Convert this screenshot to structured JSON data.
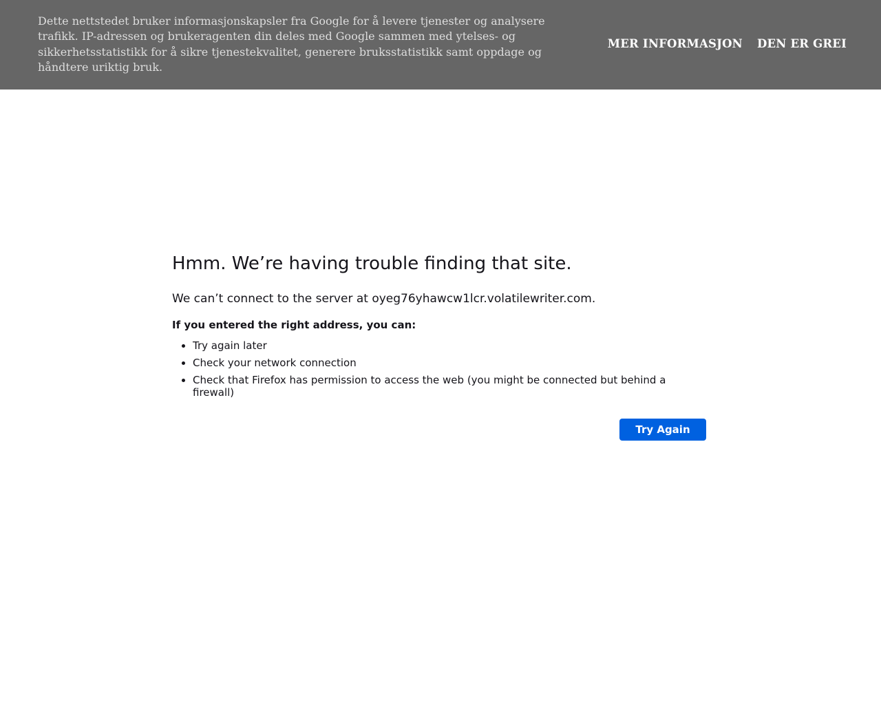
{
  "cookie_banner": {
    "message": "Dette nettstedet bruker informasjonskapsler fra Google for å levere tjenester og analysere trafikk. IP-adressen og brukeragenten din deles med Google sammen med ytelses- og sikkerhetsstatistikk for å sikre tjenestekvalitet, generere bruksstatistikk samt oppdage og håndtere uriktig bruk.",
    "more_info_label": "MER INFORMASJON",
    "accept_label": "DEN ER GREI"
  },
  "error_page": {
    "title": "Hmm. We’re having trouble finding that site.",
    "description": "We can’t connect to the server at oyeg76yhawcw1lcr.volatilewriter.com.",
    "subhead": "If you entered the right address, you can:",
    "suggestions": [
      "Try again later",
      "Check your network connection",
      "Check that Firefox has permission to access the web (you might be connected but behind a firewall)"
    ],
    "try_again_label": "Try Again"
  },
  "colors": {
    "banner_bg": "#666666",
    "primary_button": "#0061e0"
  }
}
